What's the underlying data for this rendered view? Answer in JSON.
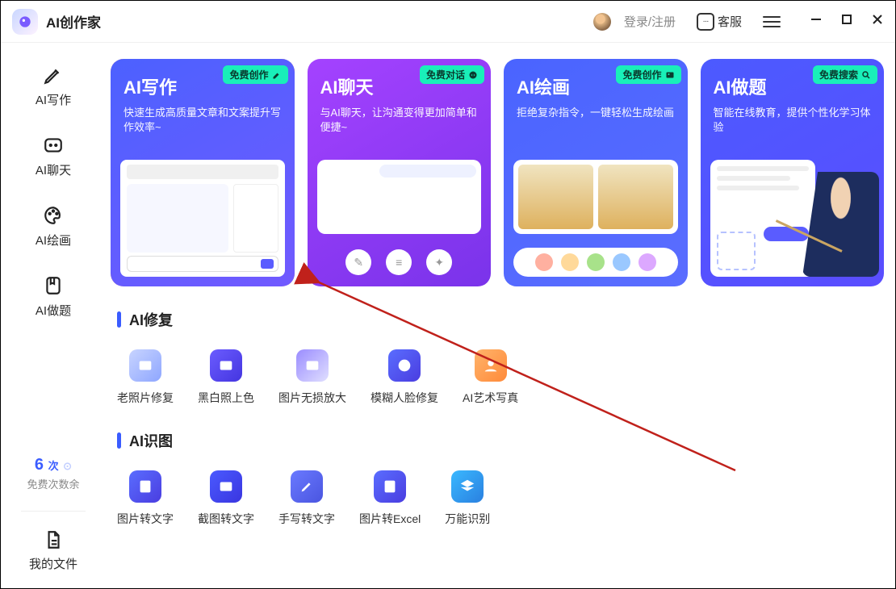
{
  "titlebar": {
    "app_name": "AI创作家",
    "login": "登录/注册",
    "customer_service": "客服"
  },
  "sidebar": {
    "nav": [
      {
        "label": "AI写作"
      },
      {
        "label": "AI聊天"
      },
      {
        "label": "AI绘画"
      },
      {
        "label": "AI做题"
      }
    ],
    "remaining": {
      "count": "6",
      "count_suffix": "次",
      "sub": "免费次数余"
    },
    "my_files": "我的文件"
  },
  "cards": [
    {
      "title": "AI写作",
      "desc": "快速生成高质量文章和文案提升写作效率~",
      "tag": "免费创作"
    },
    {
      "title": "AI聊天",
      "desc": "与AI聊天，让沟通变得更加简单和便捷~",
      "tag": "免费对话"
    },
    {
      "title": "AI绘画",
      "desc": "拒绝复杂指令，一键轻松生成绘画",
      "tag": "免费创作"
    },
    {
      "title": "AI做题",
      "desc": "智能在线教育，提供个性化学习体验",
      "tag": "免费搜索"
    }
  ],
  "sections": {
    "repair": {
      "title": "AI修复",
      "tools": [
        "老照片修复",
        "黑白照上色",
        "图片无损放大",
        "模糊人脸修复",
        "AI艺术写真"
      ]
    },
    "ocr": {
      "title": "AI识图",
      "tools": [
        "图片转文字",
        "截图转文字",
        "手写转文字",
        "图片转Excel",
        "万能识别"
      ]
    }
  }
}
